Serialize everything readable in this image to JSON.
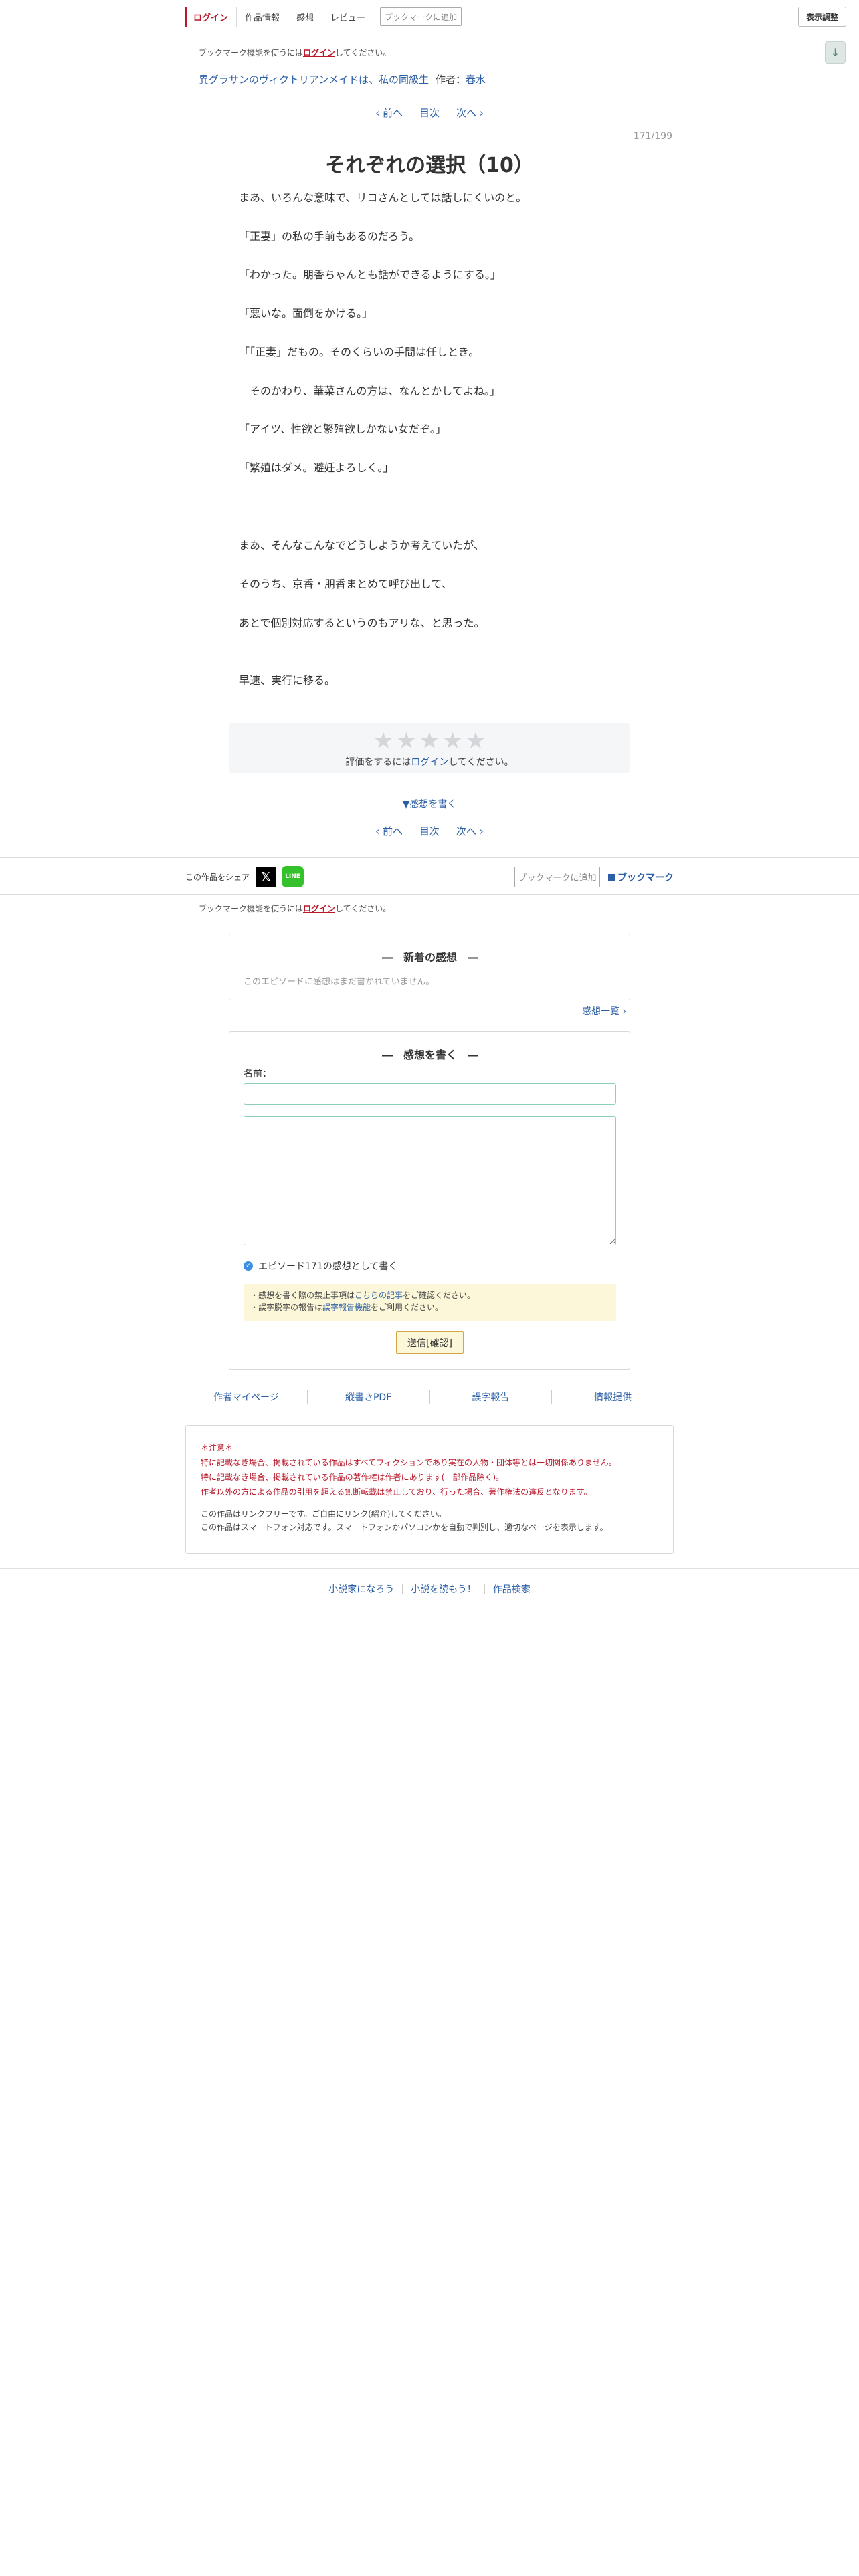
{
  "header": {
    "nav": [
      "ログイン",
      "作品情報",
      "感想",
      "レビュー"
    ],
    "bookmark_add": "ブックマークに追加",
    "display_settings": "表示調整",
    "scroll_arrow": "↓"
  },
  "bookmark_notice": {
    "prefix": "ブックマーク機能を使うには",
    "login": "ログイン",
    "suffix": "してください。"
  },
  "work": {
    "title": "異グラサンのヴィクトリアンメイドは、私の同級生",
    "author_label": "作者：",
    "author": "春水"
  },
  "pager": {
    "prev": "‹ 前へ",
    "toc": "目次",
    "next": "次へ ›"
  },
  "page_count": "171/199",
  "chapter_title": "それぞれの選択（10）",
  "body": [
    "まあ、いろんな意味で、リコさんとしては話しにくいのと。",
    "「正妻」の私の手前もあるのだろう。",
    "「わかった。朋香ちゃんとも話ができるようにする。」",
    "「悪いな。面倒をかける。」",
    "「「正妻」だもの。そのくらいの手間は任しとき。",
    "　そのかわり、華菜さんの方は、なんとかしてよね。」",
    "「アイツ、性欲と繁殖欲しかない女だぞ。」",
    "「繁殖はダメ。避妊よろしく。」",
    "まあ、そんなこんなでどうしようか考えていたが、",
    "そのうち、京香・朋香まとめて呼び出して、",
    "あとで個別対応するというのもアリな、と思った。",
    "早速、実行に移る。"
  ],
  "rating": {
    "stars": 5,
    "star_glyph": "★",
    "note_prefix": "評価をするには",
    "note_login": "ログイン",
    "note_suffix": "してください。"
  },
  "write_impression_link": "▼感想を書く",
  "share": {
    "label": "この作品をシェア",
    "x_glyph": "𝕏",
    "line_glyph": "LINE",
    "bookmark_add": "ブックマークに追加",
    "bookmark": "ブックマーク"
  },
  "latest_impressions": {
    "title": "―　新着の感想　―",
    "empty": "このエピソードに感想はまだ書かれていません。",
    "list_link": "感想一覧 ›"
  },
  "write_impression": {
    "title": "―　感想を書く　―",
    "name_label": "名前：",
    "name_value": "",
    "body_value": "",
    "episode_check": "エピソード171の感想として書く",
    "check_glyph": "✓",
    "notice1_prefix": "・感想を書く際の禁止事項は",
    "notice1_link": "こちらの記事",
    "notice1_suffix": "をご確認ください。",
    "notice2_prefix": "・誤字脱字の報告は",
    "notice2_link": "誤字報告機能",
    "notice2_suffix": "をご利用ください。",
    "submit": "送信[確認]"
  },
  "footer_links": [
    "作者マイページ",
    "縦書きPDF",
    "誤字報告",
    "情報提供"
  ],
  "caution": {
    "heading": "＊注意＊",
    "lines": [
      "特に記載なき場合、掲載されている作品はすべてフィクションであり実在の人物・団体等とは一切関係ありません。",
      "特に記載なき場合、掲載されている作品の著作権は作者にあります(一部作品除く)。",
      "作者以外の方による作品の引用を超える無断転載は禁止しており、行った場合、著作権法の違反となります。"
    ],
    "info": [
      "この作品はリンクフリーです。ご自由にリンク(紹介)してください。",
      "この作品はスマートフォン対応です。スマートフォンかパソコンかを自動で判別し、適切なページを表示します。"
    ]
  },
  "bottom_nav": [
    "小説家になろう",
    "小説を読もう！",
    "作品検索"
  ]
}
